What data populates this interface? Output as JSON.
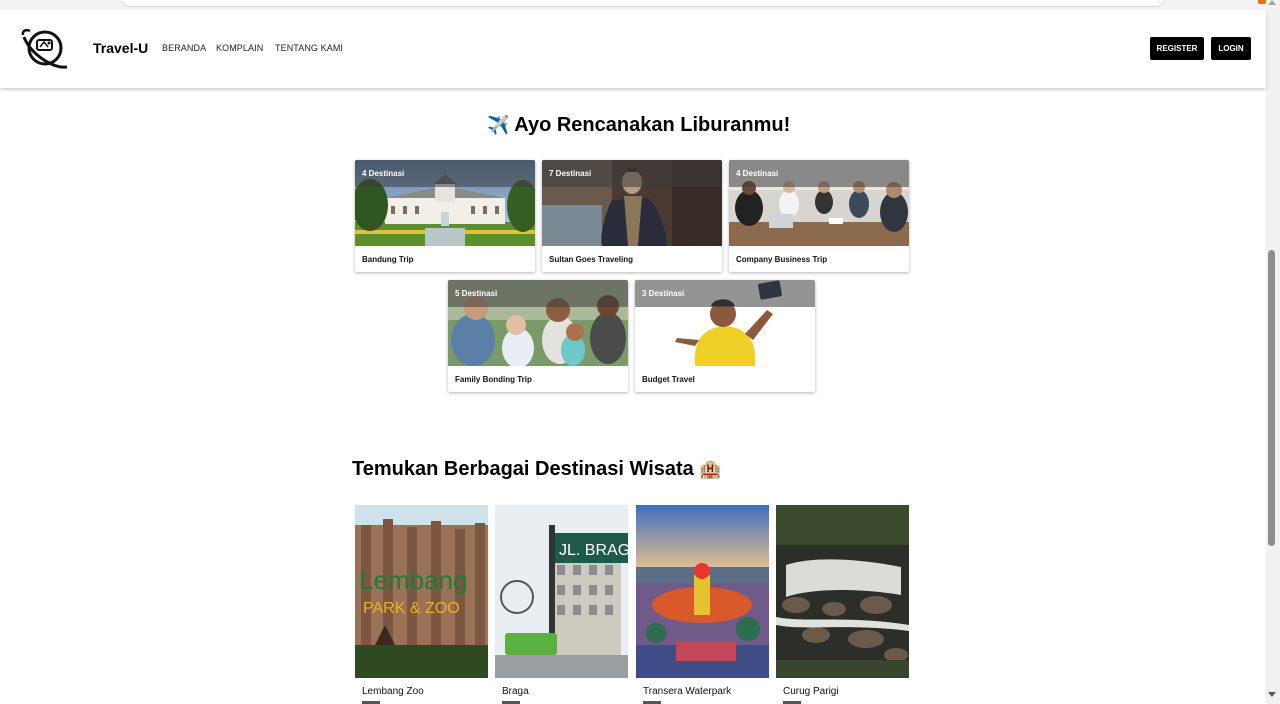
{
  "navbar": {
    "brand": "Travel-U",
    "links": [
      "BERANDA",
      "KOMPLAIN",
      "TENTANG KAMI"
    ],
    "register_label": "REGISTER",
    "login_label": "LOGIN"
  },
  "plan_section": {
    "title": "Ayo Rencanakan Liburanmu!",
    "emoji": "✈️"
  },
  "categories": [
    {
      "count": "4 Destinasi",
      "name": "Bandung Trip"
    },
    {
      "count": "7 Destinasi",
      "name": "Sultan Goes Traveling"
    },
    {
      "count": "4 Destinasi",
      "name": "Company Business Trip"
    },
    {
      "count": "5 Destinasi",
      "name": "Family Bonding Trip"
    },
    {
      "count": "3 Destinasi",
      "name": "Budget Travel"
    }
  ],
  "destinations_section": {
    "title": "Temukan Berbagai Destinasi Wisata",
    "emoji": "🏨"
  },
  "destinations": [
    {
      "name": "Lembang Zoo",
      "photo_text_1": "Lembang",
      "photo_text_2": "PARK & ZOO"
    },
    {
      "name": "Braga",
      "photo_text_1": "JL. BRAGA"
    },
    {
      "name": "Transera Waterpark"
    },
    {
      "name": "Curug Parigi"
    }
  ]
}
